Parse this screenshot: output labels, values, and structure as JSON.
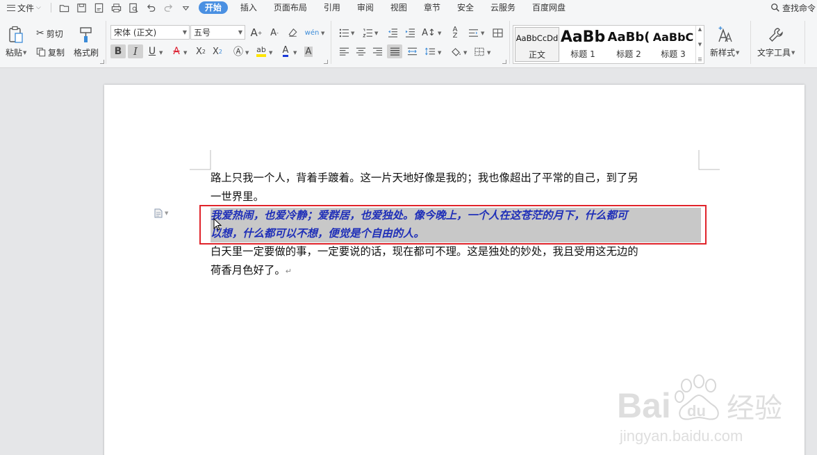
{
  "menubar": {
    "file_label": "文件",
    "tabs": [
      "开始",
      "插入",
      "页面布局",
      "引用",
      "审阅",
      "视图",
      "章节",
      "安全",
      "云服务",
      "百度网盘"
    ],
    "active_tab": "开始",
    "search_label": "查找命令"
  },
  "ribbon": {
    "paste_label": "粘贴",
    "cut_label": "剪切",
    "copy_label": "复制",
    "format_painter_label": "格式刷",
    "font_name": "宋体 (正文)",
    "font_size": "五号",
    "styles": [
      {
        "sample": "AaBbCcDd",
        "name": "正文"
      },
      {
        "sample": "AaBb",
        "name": "标题 1"
      },
      {
        "sample": "AaBb(",
        "name": "标题 2"
      },
      {
        "sample": "AaBbC",
        "name": "标题 3"
      }
    ],
    "new_style_label": "新样式",
    "text_tools_label": "文字工具"
  },
  "document": {
    "para1_line1": "路上只我一个人，背着手踱着。这一片天地好像是我的；我也像超出了平常的自己，到了另",
    "para1_line2": "一世界里。",
    "para2_line1": "我爱热闹，也爱冷静；爱群居，也爱独处。像今晚上，一个人在这苍茫的月下，什么都可",
    "para2_line2": "以想，什么都可以不想，便觉是个自由的人。",
    "para3_line1": "白天里一定要做的事，一定要说的话，现在都可不理。这是独处的妙处，我且受用这无边的",
    "para3_line2": "荷香月色好了。",
    "paragraph_mark": "↵"
  },
  "watermark": {
    "brand": "Bai",
    "brand_end": "du",
    "cn": "经验",
    "url": "jingyan.baidu.com"
  },
  "colors": {
    "active_tab": "#4a90e2",
    "selected_text": "#1f2fb8",
    "highlight_box": "#e0232a",
    "selection_bg": "#c8c8c8"
  }
}
